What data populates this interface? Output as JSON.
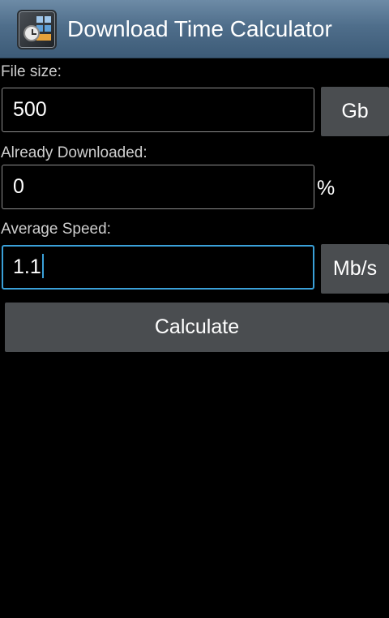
{
  "app": {
    "title": "Download Time Calculator",
    "icon": "calculator-clock-icon"
  },
  "file_size": {
    "label": "File size:",
    "value": "500",
    "unit": "Gb"
  },
  "already_downloaded": {
    "label": "Already Downloaded:",
    "value": "0",
    "unit": "%"
  },
  "average_speed": {
    "label": "Average Speed:",
    "value": "1.1",
    "unit": "Mb/s"
  },
  "calculate_button": {
    "label": "Calculate"
  }
}
